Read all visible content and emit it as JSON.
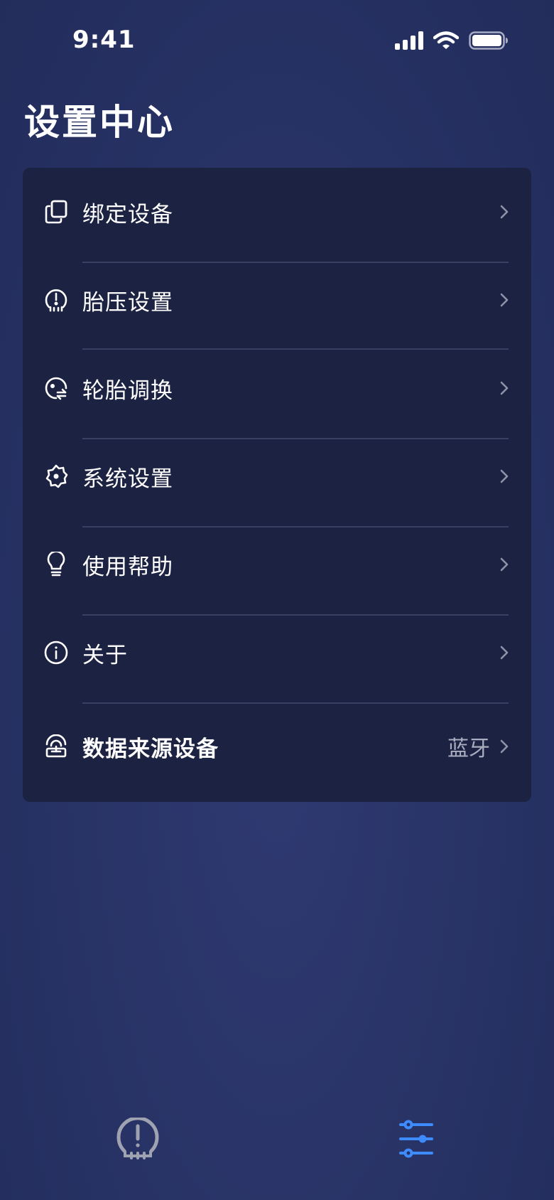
{
  "status_bar": {
    "time": "9:41",
    "icons": [
      "cellular-signal-icon",
      "wifi-icon",
      "battery-icon"
    ]
  },
  "page": {
    "title": "设置中心"
  },
  "menu": {
    "items": [
      {
        "label": "绑定设备",
        "icon": "copy-devices-icon"
      },
      {
        "label": "胎压设置",
        "icon": "tire-pressure-icon"
      },
      {
        "label": "轮胎调换",
        "icon": "tire-rotation-icon"
      },
      {
        "label": "系统设置",
        "icon": "gear-icon"
      },
      {
        "label": "使用帮助",
        "icon": "lightbulb-icon"
      },
      {
        "label": "关于",
        "icon": "info-icon"
      },
      {
        "label": "数据来源设备",
        "icon": "signal-device-icon",
        "value": "蓝牙"
      }
    ]
  },
  "tabbar": {
    "tabs": [
      {
        "icon": "tire-pressure-icon",
        "active": false
      },
      {
        "icon": "sliders-icon",
        "active": true
      }
    ]
  },
  "colors": {
    "background": "#2a3468",
    "card": "#1c2242",
    "divider": "#3b4062",
    "accent": "#3d8bff",
    "inactive_icon": "#9fa2b0",
    "secondary_text": "#a9adbf"
  }
}
